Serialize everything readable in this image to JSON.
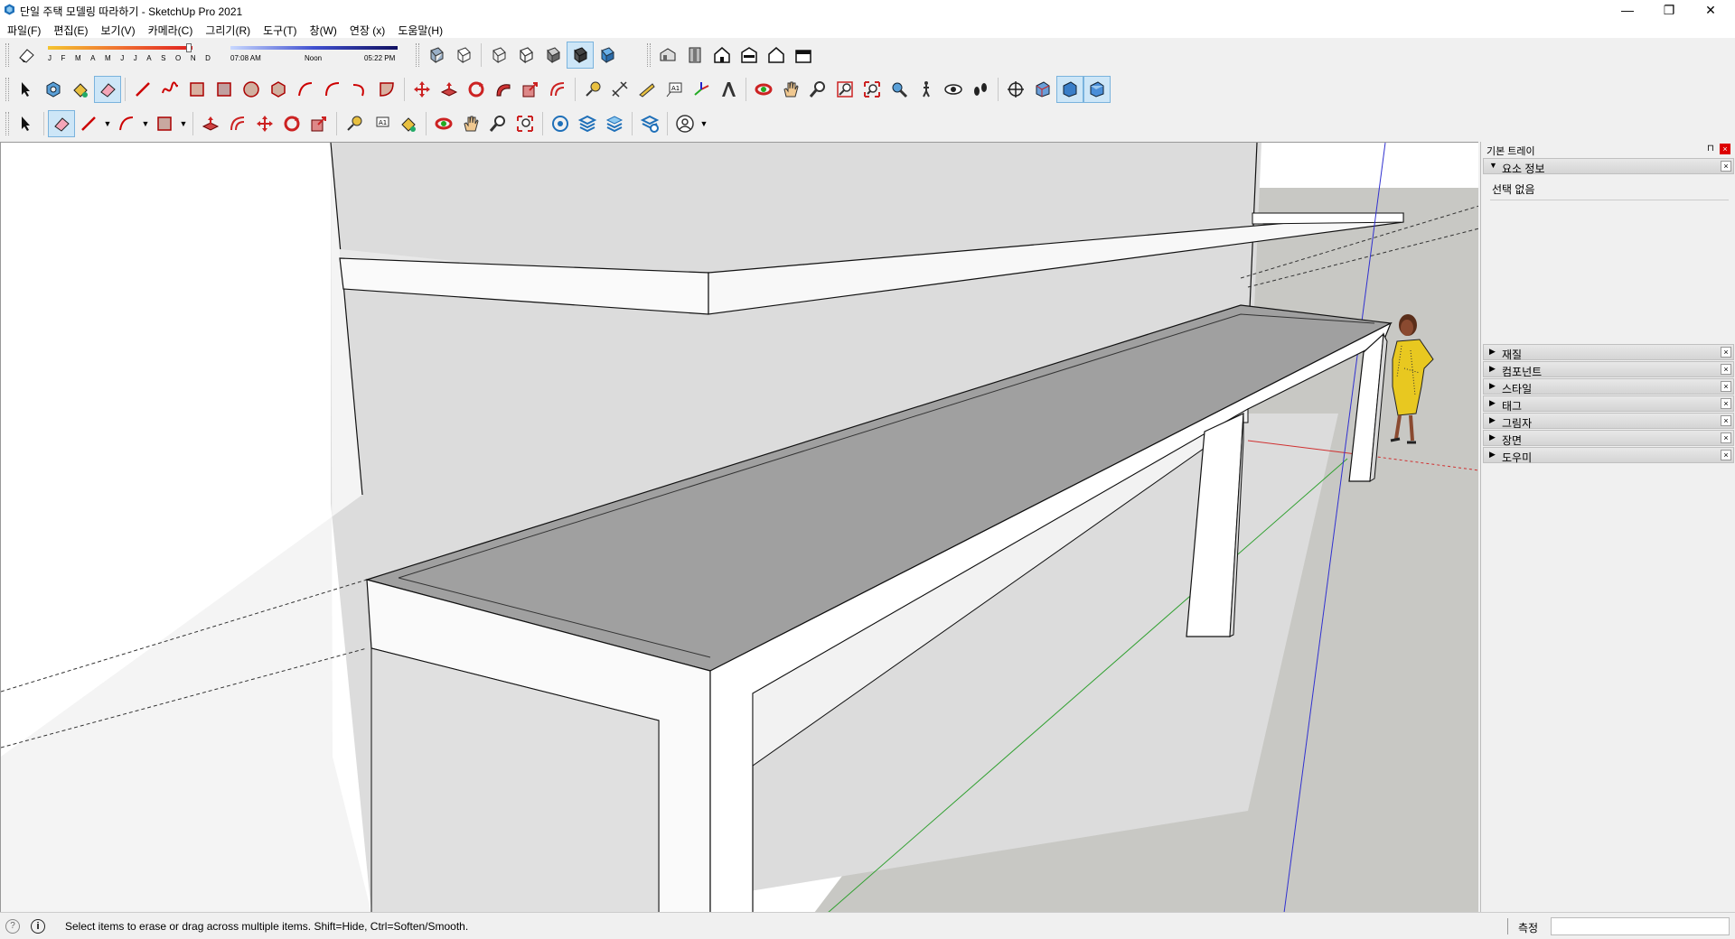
{
  "window": {
    "title": "단일 주택 모델링 따라하기 - SketchUp Pro 2021",
    "minimize": "—",
    "maximize": "❐",
    "close": "✕"
  },
  "menu": [
    "파일(F)",
    "편집(E)",
    "보기(V)",
    "카메라(C)",
    "그리기(R)",
    "도구(T)",
    "창(W)",
    "연장 (x)",
    "도움말(H)"
  ],
  "shadows": {
    "months": [
      "J",
      "F",
      "M",
      "A",
      "M",
      "J",
      "J",
      "A",
      "S",
      "O",
      "N",
      "D"
    ],
    "time_start": "07:08 AM",
    "time_noon": "Noon",
    "time_end": "05:22 PM"
  },
  "toolbars": {
    "row1_icons": [
      "eraser-icon",
      "shadow-settings-icon",
      "xray-icon",
      "back-edges-icon",
      "wireframe-icon",
      "hidden-line-icon",
      "shaded-icon",
      "shaded-textures-icon",
      "monochrome-icon",
      "iso-view-icon",
      "top-view-icon",
      "front-view-icon",
      "right-view-icon",
      "back-view-icon",
      "left-view-icon"
    ],
    "row2_icons": [
      "select-icon",
      "make-component-icon",
      "paint-bucket-icon",
      "eraser-icon",
      "line-icon",
      "freehand-icon",
      "rectangle-icon",
      "rotated-rectangle-icon",
      "circle-icon",
      "polygon-icon",
      "arc-icon",
      "two-point-arc-icon",
      "three-point-arc-icon",
      "pie-icon",
      "move-icon",
      "push-pull-icon",
      "rotate-icon",
      "follow-me-icon",
      "scale-icon",
      "offset-icon",
      "tape-measure-icon",
      "dimension-icon",
      "protractor-icon",
      "text-icon",
      "axes-icon",
      "3d-text-icon",
      "orbit-icon",
      "pan-icon",
      "zoom-icon",
      "zoom-window-icon",
      "zoom-extents-icon",
      "position-camera-icon",
      "walk-icon",
      "look-around-icon",
      "footprints-icon",
      "section-plane-icon",
      "display-section-planes-icon",
      "display-section-cuts-icon",
      "display-section-fill-icon"
    ],
    "row3_icons": [
      "select-icon",
      "eraser-icon",
      "line-icon",
      "arc-icon",
      "rectangle-icon",
      "push-pull-icon",
      "offset-icon",
      "move-icon",
      "rotate-icon",
      "scale-icon",
      "tape-measure-icon",
      "text-icon",
      "paint-bucket-icon",
      "orbit-icon",
      "pan-icon",
      "zoom-icon",
      "zoom-extents-icon",
      "warehouse-icon",
      "extension-icon",
      "layers-icon",
      "sandbox-icon",
      "account-icon"
    ]
  },
  "tray": {
    "title": "기본 트레이",
    "pin": "⊓",
    "close": "×",
    "entity_info": {
      "title": "요소 정보",
      "body": "선택 없음"
    },
    "panels": [
      "재질",
      "컴포넌트",
      "스타일",
      "태그",
      "그림자",
      "장면",
      "도우미"
    ]
  },
  "status": {
    "geo": "?",
    "info": "i",
    "message": "Select items to erase or drag across multiple items. Shift=Hide, Ctrl=Soften/Smooth.",
    "measure_label": "측정",
    "measure_value": ""
  },
  "colors": {
    "sky": "#ffffff",
    "ground": "#c8c8c4",
    "wall": "#dcdcdc",
    "table_top": "#a0a0a0",
    "edge": "#1a1a1a",
    "axis_red": "#d03030",
    "axis_green": "#30a030",
    "axis_blue": "#3030d0",
    "selected_tool": "#cde6f7"
  }
}
